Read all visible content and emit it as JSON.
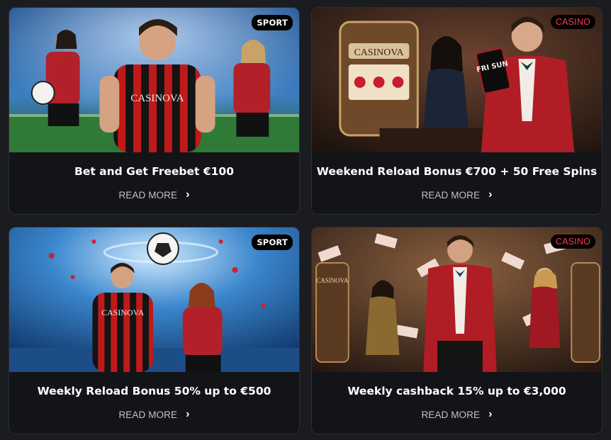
{
  "cards": [
    {
      "badge": "SPORT",
      "badge_type": "sport",
      "title": "Bet and Get Freebet €100",
      "link": "READ MORE",
      "icon": "chevron-right-icon",
      "shirt_text": "CASINOVA"
    },
    {
      "badge": "CASINO",
      "badge_type": "casino",
      "title": "Weekend Reload Bonus €700 + 50 Free Spins",
      "link": "READ MORE",
      "icon": "chevron-right-icon",
      "card_text": "FRI SUN",
      "machine_text": "CASINOVA"
    },
    {
      "badge": "SPORT",
      "badge_type": "sport",
      "title": "Weekly Reload Bonus 50% up to €500",
      "link": "READ MORE",
      "icon": "chevron-right-icon",
      "shirt_text": "CASINOVA"
    },
    {
      "badge": "CASINO",
      "badge_type": "casino",
      "title": "Weekly cashback 15% up to €3,000",
      "link": "READ MORE",
      "icon": "chevron-right-icon",
      "machine_text": "CASINOVA"
    }
  ],
  "colors": {
    "background": "#1b1c20",
    "card": "#131418",
    "casino_badge": "#ff3b4b"
  }
}
